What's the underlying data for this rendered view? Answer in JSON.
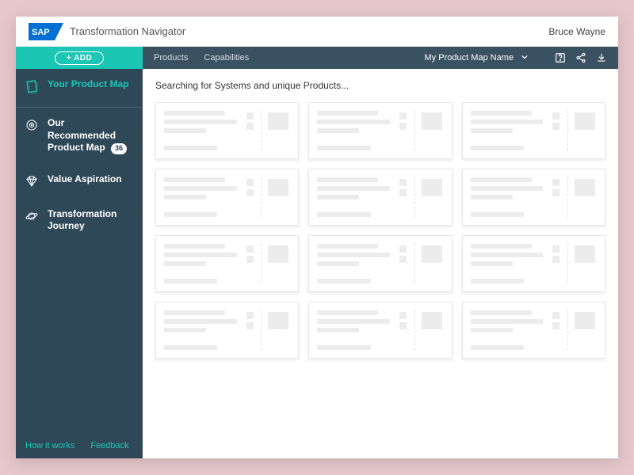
{
  "header": {
    "app_name": "Transformation Navigator",
    "username": "Bruce Wayne",
    "logo_fill": "#0070d2"
  },
  "sidebar": {
    "add_label": "ADD",
    "items": [
      {
        "label": "Your Product Map",
        "icon": "map-icon",
        "active": true
      },
      {
        "label": "Our Recommended Product Map",
        "icon": "target-icon",
        "badge": "36"
      },
      {
        "label": "Value Aspiration",
        "icon": "diamond-icon"
      },
      {
        "label": "Transformation Journey",
        "icon": "planet-icon"
      }
    ],
    "footer": {
      "how": "How it works",
      "feedback": "Feedback"
    }
  },
  "toolbar": {
    "tabs": [
      "Products",
      "Capabilities"
    ],
    "map_name": "My Product Map Name"
  },
  "content": {
    "status": "Searching for Systems and unique Products...",
    "card_count": 12
  },
  "colors": {
    "accent": "#1bc6b4",
    "sidebar_bg": "#2e4858",
    "toolbar_bg": "#3a5161"
  }
}
